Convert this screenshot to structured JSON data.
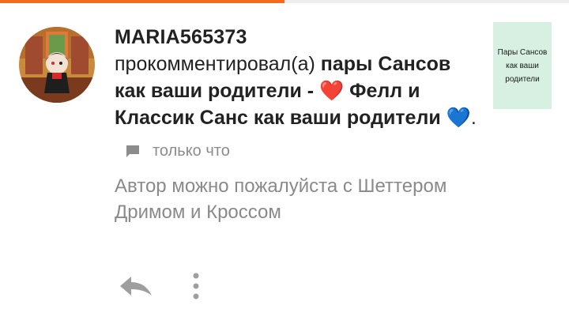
{
  "progress": {
    "value_percent": 50,
    "color": "#f26b21"
  },
  "comment": {
    "username": "MARIA565373",
    "action_text": "прокомментировал(а)",
    "post_title_part1": "пары Сансов как ваши родители -",
    "post_title_part2": "Фелл и Классик Санс как ваши родители",
    "heart_emoji": "❤️",
    "blue_heart_emoji": "💙",
    "trailing_punct": ".",
    "timestamp": "только что",
    "reply_text": "Автор можно пожалуйста с Шеттером Дримом и Кроссом"
  },
  "thumbnail": {
    "text": "Пары Сансов как ваши родители",
    "background": "#d8f0e2"
  },
  "icons": {
    "chat": "chat-bubble-icon",
    "reply": "reply-arrow-icon",
    "more": "more-vertical-icon"
  }
}
